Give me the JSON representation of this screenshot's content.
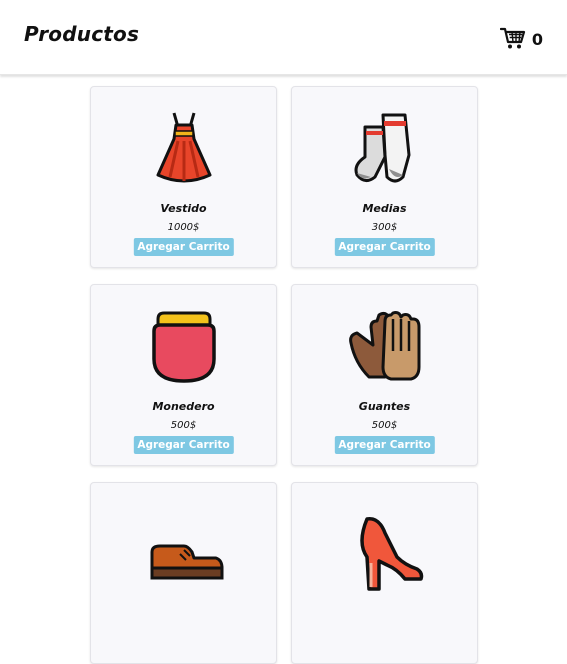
{
  "header": {
    "title": "Productos",
    "cart_icon": "shopping-cart-icon",
    "cart_count": "0"
  },
  "products": [
    {
      "name": "Vestido",
      "price": "1000$",
      "button": "Agregar Carrito",
      "icon": "dress-icon"
    },
    {
      "name": "Medias",
      "price": "300$",
      "button": "Agregar Carrito",
      "icon": "socks-icon"
    },
    {
      "name": "Monedero",
      "price": "500$",
      "button": "Agregar Carrito",
      "icon": "purse-icon"
    },
    {
      "name": "Guantes",
      "price": "500$",
      "button": "Agregar Carrito",
      "icon": "gloves-icon"
    },
    {
      "icon": "shoe-icon"
    },
    {
      "icon": "high-heel-icon"
    }
  ],
  "colors": {
    "button_bg": "#7ec8e3",
    "card_bg": "#f8f8fb"
  }
}
